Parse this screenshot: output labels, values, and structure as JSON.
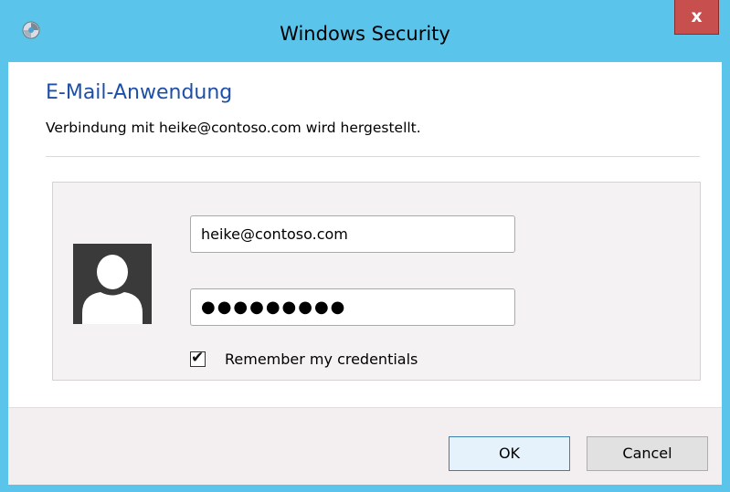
{
  "window": {
    "title": "Windows Security",
    "close_label": "x",
    "icon": "security-shield-icon"
  },
  "dialog": {
    "heading": "E-Mail-Anwendung",
    "subtext": "Verbindung mit heike@contoso.com wird hergestellt."
  },
  "credentials": {
    "avatar_icon": "user-avatar-icon",
    "username_value": "heike@contoso.com",
    "password_value": "●●●●●●●●●",
    "remember_checked": true,
    "remember_label": "Remember my credentials"
  },
  "buttons": {
    "ok_label": "OK",
    "cancel_label": "Cancel"
  },
  "colors": {
    "titlebar": "#5bc4ea",
    "close_button": "#c7504f",
    "heading_text": "#1e4fa8",
    "panel_background": "#f5f2f3",
    "ok_border": "#3c7fb1"
  }
}
